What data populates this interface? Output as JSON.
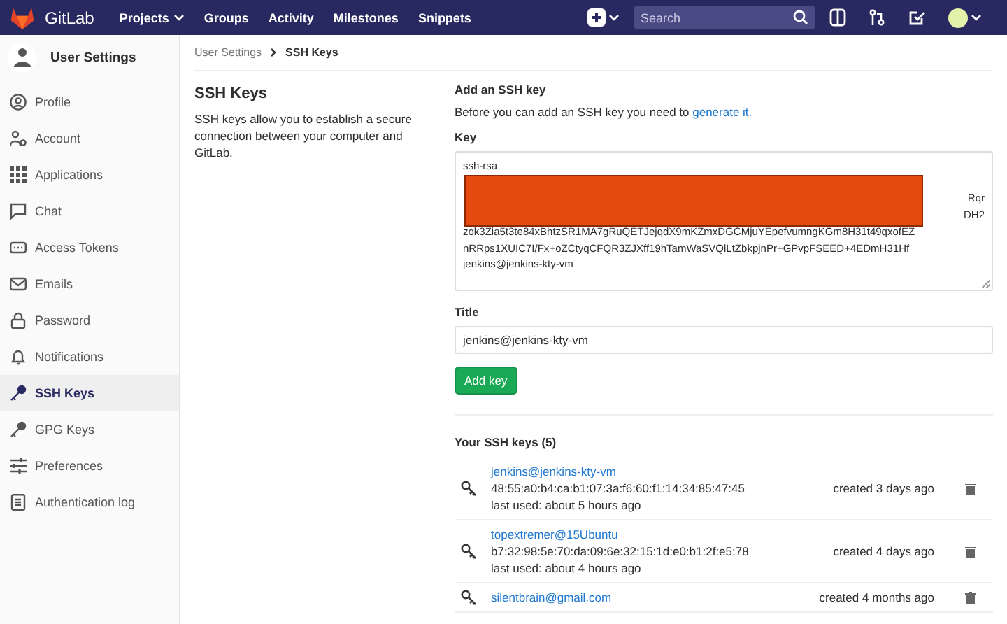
{
  "topbar": {
    "brand": "GitLab",
    "nav": [
      {
        "label": "Projects",
        "dropdown": true
      },
      {
        "label": "Groups",
        "dropdown": false
      },
      {
        "label": "Activity",
        "dropdown": false
      },
      {
        "label": "Milestones",
        "dropdown": false
      },
      {
        "label": "Snippets",
        "dropdown": false
      }
    ],
    "search": {
      "placeholder": "Search"
    }
  },
  "sidebar": {
    "title": "User Settings",
    "items": [
      {
        "label": "Profile",
        "selected": false
      },
      {
        "label": "Account",
        "selected": false
      },
      {
        "label": "Applications",
        "selected": false
      },
      {
        "label": "Chat",
        "selected": false
      },
      {
        "label": "Access Tokens",
        "selected": false
      },
      {
        "label": "Emails",
        "selected": false
      },
      {
        "label": "Password",
        "selected": false
      },
      {
        "label": "Notifications",
        "selected": false
      },
      {
        "label": "SSH Keys",
        "selected": true
      },
      {
        "label": "GPG Keys",
        "selected": false
      },
      {
        "label": "Preferences",
        "selected": false
      },
      {
        "label": "Authentication log",
        "selected": false
      }
    ]
  },
  "breadcrumb": [
    "User Settings",
    "SSH Keys"
  ],
  "intro": {
    "title": "SSH Keys",
    "text": "SSH keys allow you to establish a secure connection between your computer and GitLab."
  },
  "add_key": {
    "heading": "Add an SSH key",
    "text": "Before you can add an SSH key you need to ",
    "link": "generate it.",
    "key_label": "Key",
    "key_lines": [
      {
        "kind": "text",
        "text": "ssh-rsa"
      },
      {
        "kind": "hidden"
      },
      {
        "kind": "tail",
        "text": "Rqr"
      },
      {
        "kind": "tail",
        "text": "DH2"
      },
      {
        "kind": "text",
        "text": "zok3Zia5t3te84xBhtzSR1MA7gRuQETJejqdX9mKZmxDGCMjuYEpefvumngKGm8H31t49qxofEZ"
      },
      {
        "kind": "text",
        "text": "nRRps1XUIC7I/Fx+oZCtyqCFQR3ZJXff19hTamWaSVQlLtZbkpjnPr+GPvpFSEED+4EDmH31Hf"
      },
      {
        "kind": "text",
        "text": "jenkins@jenkins-kty-vm"
      }
    ],
    "title_label": "Title",
    "title_value": "jenkins@jenkins-kty-vm",
    "button": "Add key"
  },
  "keys": {
    "heading": "Your SSH keys (5)",
    "items": [
      {
        "title": "jenkins@jenkins-kty-vm",
        "fingerprint": "48:55:a0:b4:ca:b1:07:3a:f6:60:f1:14:34:85:47:45",
        "last_used": "last used: about 5 hours ago",
        "created": "created 3 days ago"
      },
      {
        "title": "topextremer@15Ubuntu",
        "fingerprint": "b7:32:98:5e:70:da:09:6e:32:15:1d:e0:b1:2f:e5:78",
        "last_used": "last used: about 4 hours ago",
        "created": "created 4 days ago"
      },
      {
        "title": "silentbrain@gmail.com",
        "created": "created 4 months ago"
      }
    ]
  }
}
